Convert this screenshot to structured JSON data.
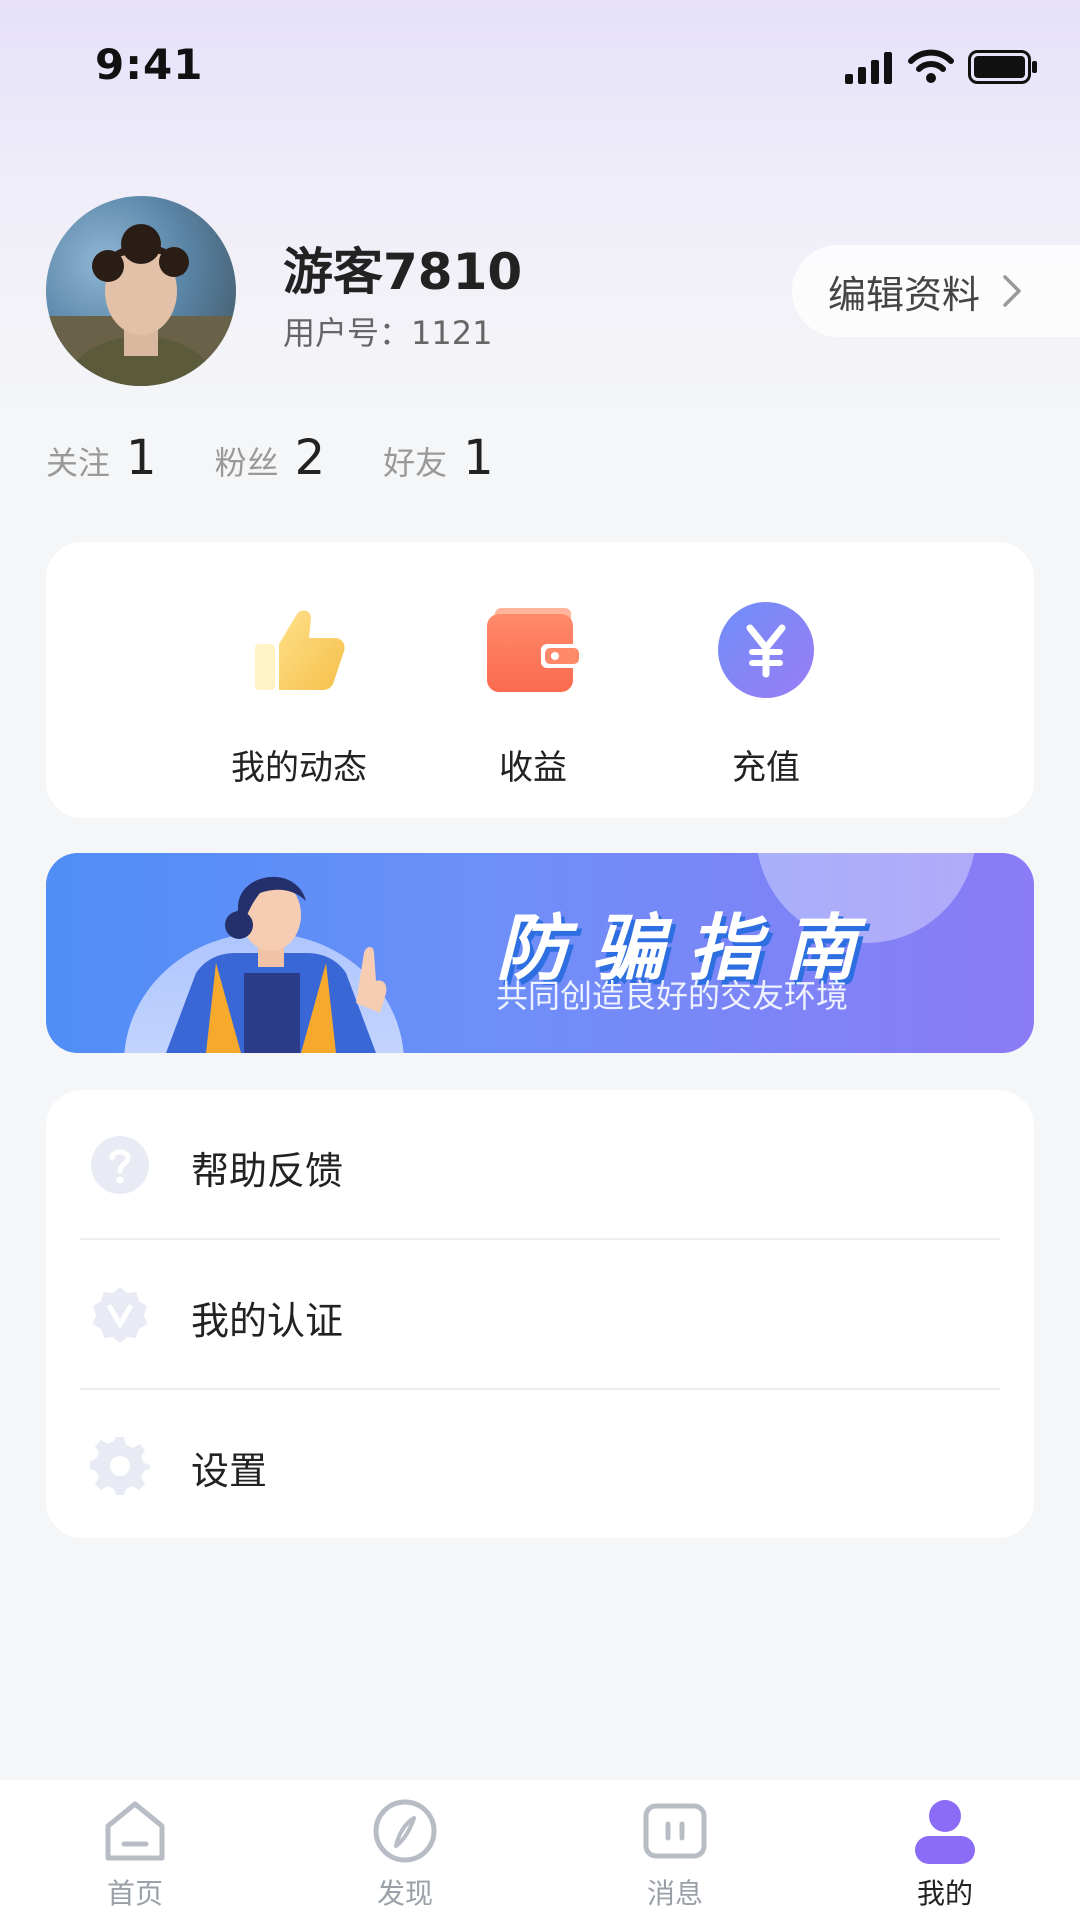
{
  "status_bar": {
    "time": "9:41"
  },
  "profile": {
    "username": "游客7810",
    "user_id_text": "用户号：1121",
    "edit_label": "编辑资料"
  },
  "stats": [
    {
      "label": "关注",
      "value": "1"
    },
    {
      "label": "粉丝",
      "value": "2"
    },
    {
      "label": "好友",
      "value": "1"
    }
  ],
  "quick_actions": [
    {
      "label": "我的动态",
      "icon": "thumbs-up-icon"
    },
    {
      "label": "收益",
      "icon": "wallet-icon"
    },
    {
      "label": "充值",
      "icon": "yen-icon"
    }
  ],
  "banner": {
    "title": "防骗指南",
    "subtitle": "共同创造良好的交友环境"
  },
  "menu": [
    {
      "label": "帮助反馈",
      "icon": "help-icon"
    },
    {
      "label": "我的认证",
      "icon": "verified-badge-icon"
    },
    {
      "label": "设置",
      "icon": "gear-icon"
    }
  ],
  "tabs": [
    {
      "label": "首页",
      "icon": "home-icon",
      "active": false
    },
    {
      "label": "发现",
      "icon": "compass-icon",
      "active": false
    },
    {
      "label": "消息",
      "icon": "message-icon",
      "active": false
    },
    {
      "label": "我的",
      "icon": "user-icon",
      "active": true
    }
  ],
  "colors": {
    "accent": "#8b6cf6",
    "banner_start": "#4f8ef6",
    "banner_end": "#8b7bf6",
    "text_primary": "#222222",
    "text_muted": "#999999"
  }
}
